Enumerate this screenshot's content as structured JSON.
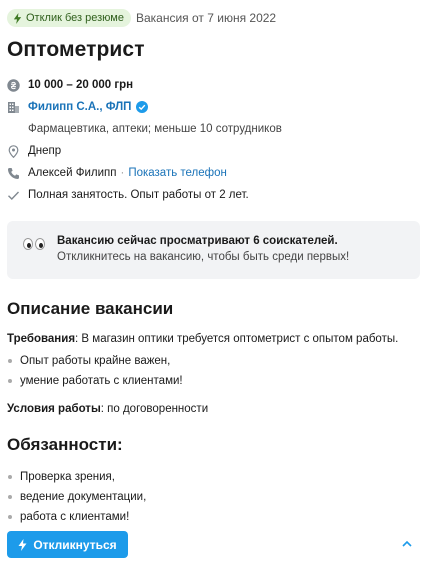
{
  "header": {
    "badge": "Отклик без резюме",
    "posted": "Вакансия от 7 июня 2022"
  },
  "title": "Оптометрист",
  "details": {
    "salary": "10 000 – 20 000 грн",
    "company": "Филипп С.А., ФЛП",
    "company_info": "Фармацевтика, аптеки; меньше 10 сотрудников",
    "city": "Днепр",
    "contact_name": "Алексей Филипп",
    "show_phone": "Показать телефон",
    "employment": "Полная занятость. Опыт работы от 2 лет."
  },
  "notice": {
    "title": "Вакансию сейчас просматривают 6 соискателей.",
    "subtitle": "Откликнитесь на вакансию, чтобы быть среди первых!"
  },
  "description": {
    "heading": "Описание вакансии",
    "requirements_label": "Требования",
    "requirements_text": ": В магазин оптики требуется оптометрист с опытом работы.",
    "requirements_list": [
      "Опыт работы крайне важен,",
      "умение работать с клиентами!"
    ],
    "conditions_label": "Условия работы",
    "conditions_text": ": по договоренности"
  },
  "duties": {
    "heading": "Обязанности:",
    "list": [
      "Проверка зрения,",
      "ведение документации,",
      "работа с клиентами!"
    ]
  },
  "apply_label": "Откликнуться",
  "colors": {
    "accent": "#1d9bea",
    "link": "#1a73b8",
    "badge_bg": "#e5f4dd",
    "notice_bg": "#f2f3f5"
  },
  "icons": {
    "badge": "lightning-icon",
    "salary": "hryvnia-coin-icon",
    "company": "building-icon",
    "verified": "verified-check-icon",
    "city": "location-pin-icon",
    "contact": "phone-icon",
    "employment": "checkmark-icon",
    "notice": "eyes-icon",
    "apply": "lightning-icon",
    "scroll_top": "chevron-up-icon"
  }
}
